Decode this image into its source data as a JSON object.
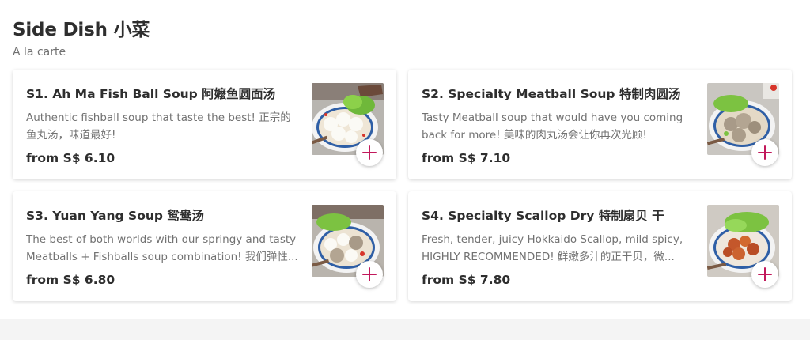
{
  "section": {
    "title": "Side Dish 小菜",
    "subtitle": "A la carte"
  },
  "items": [
    {
      "name": "S1. Ah Ma Fish Ball Soup 阿嬷鱼圆面汤",
      "description": "Authentic fishball soup that taste the best! 正宗的鱼丸汤，味道最好!",
      "price": "from S$ 6.10",
      "image": "fish-ball-soup-photo"
    },
    {
      "name": "S2. Specialty Meatball Soup 特制肉圆汤",
      "description": "Tasty Meatball soup that would have you coming back for more! 美味的肉丸汤会让你再次光顾!",
      "price": "from S$ 7.10",
      "image": "meatball-soup-photo"
    },
    {
      "name": "S3. Yuan Yang Soup 鸳鸯汤",
      "description": "The best of both worlds with our springy and tasty Meatballs + Fishballs soup combination! 我们弹性...",
      "price": "from S$ 6.80",
      "image": "yuan-yang-soup-photo"
    },
    {
      "name": "S4. Specialty Scallop Dry 特制扇贝 干",
      "description": "Fresh, tender, juicy Hokkaido Scallop, mild spicy, HIGHLY RECOMMENDED! 鲜嫩多汁的正干贝，微...",
      "price": "from S$ 7.80",
      "image": "scallop-dry-photo"
    }
  ],
  "colors": {
    "accent": "#c2185b",
    "title_text": "#2e2e2e",
    "muted_text": "#727272"
  },
  "icons": {
    "add": "plus-icon"
  }
}
